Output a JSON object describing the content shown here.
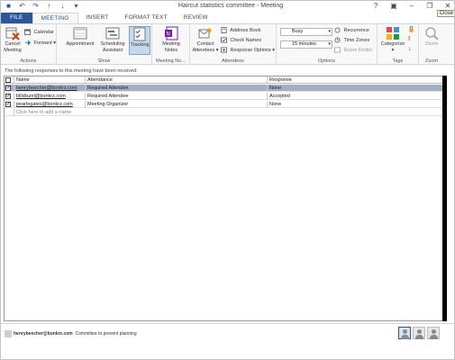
{
  "window": {
    "title": "Haircut statistics committee - Meeting",
    "help_label": "?",
    "close_tooltip": "Close"
  },
  "tabs": [
    {
      "label": "FILE"
    },
    {
      "label": "MEETING"
    },
    {
      "label": "INSERT"
    },
    {
      "label": "FORMAT TEXT"
    },
    {
      "label": "REVIEW"
    }
  ],
  "ribbon": {
    "actions": {
      "label": "Actions",
      "cancel_meeting": "Cancel Meeting",
      "calendar": "Calendar",
      "forward": "Forward"
    },
    "show": {
      "label": "Show",
      "appointment": "Appointment",
      "scheduling_assistant": "Scheduling Assistant",
      "tracking": "Tracking"
    },
    "meeting_notes": {
      "label": "Meeting No...",
      "meeting_notes": "Meeting Notes"
    },
    "attendees": {
      "label": "Attendees",
      "contact_attendees": "Contact Attendees",
      "address_book": "Address Book",
      "check_names": "Check Names",
      "response_options": "Response Options"
    },
    "options": {
      "label": "Options",
      "show_as": "Busy",
      "reminder": "15 minutes",
      "recurrence": "Recurrence",
      "time_zones": "Time Zones",
      "room_finder": "Room Finder"
    },
    "tags": {
      "label": "Tags",
      "categorize": "Categorize"
    },
    "zoom": {
      "label": "Zoom",
      "zoom": "Zoom"
    }
  },
  "content": {
    "info_text": "The following responses to this meeting have been received:",
    "columns": {
      "name": "Name",
      "attendance": "Attendance",
      "response": "Response"
    },
    "rows": [
      {
        "name": "henrybeecher@bonkrz.com",
        "attendance": "Required Attendee",
        "response": "None"
      },
      {
        "name": "billdiszel@bonkrz.com",
        "attendance": "Required Attendee",
        "response": "Accepted"
      },
      {
        "name": "pearlegates@bonkrz.com",
        "attendance": "Meeting Organizer",
        "response": "None"
      }
    ],
    "add_name_hint": "Click here to add a name"
  },
  "status": {
    "sender": "henrybeecher@bonkrz.com",
    "note": "Committee to prevent planning"
  },
  "colors": {
    "accent": "#2b579a",
    "selected_row": "#a4afc5"
  }
}
